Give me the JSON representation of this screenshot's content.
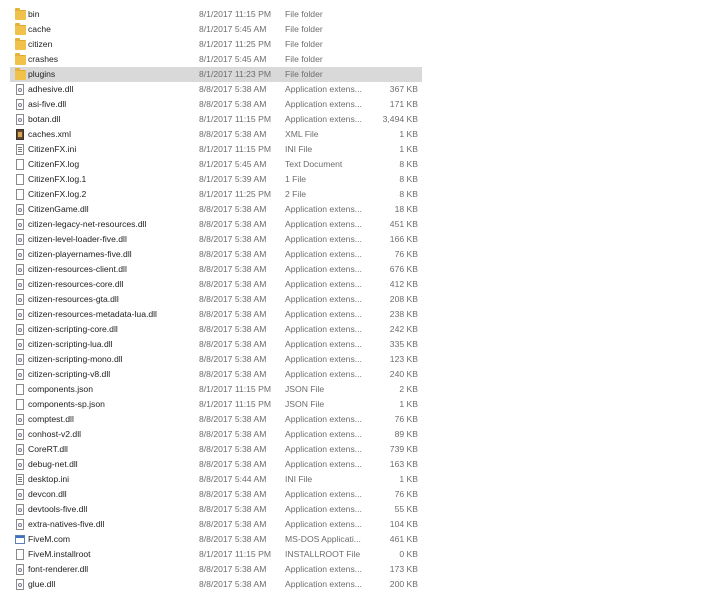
{
  "files": [
    {
      "name": "bin",
      "date": "8/1/2017 11:15 PM",
      "type": "File folder",
      "size": "",
      "icon": "folder-icon"
    },
    {
      "name": "cache",
      "date": "8/1/2017 5:45 AM",
      "type": "File folder",
      "size": "",
      "icon": "folder-icon"
    },
    {
      "name": "citizen",
      "date": "8/1/2017 11:25 PM",
      "type": "File folder",
      "size": "",
      "icon": "folder-icon"
    },
    {
      "name": "crashes",
      "date": "8/1/2017 5:45 AM",
      "type": "File folder",
      "size": "",
      "icon": "folder-icon"
    },
    {
      "name": "plugins",
      "date": "8/1/2017 11:23 PM",
      "type": "File folder",
      "size": "",
      "icon": "folder-icon",
      "selected": true
    },
    {
      "name": "adhesive.dll",
      "date": "8/8/2017 5:38 AM",
      "type": "Application extens...",
      "size": "367 KB",
      "icon": "dll-icon"
    },
    {
      "name": "asi-five.dll",
      "date": "8/8/2017 5:38 AM",
      "type": "Application extens...",
      "size": "171 KB",
      "icon": "dll-icon"
    },
    {
      "name": "botan.dll",
      "date": "8/1/2017 11:15 PM",
      "type": "Application extens...",
      "size": "3,494 KB",
      "icon": "dll-icon"
    },
    {
      "name": "caches.xml",
      "date": "8/8/2017 5:38 AM",
      "type": "XML File",
      "size": "1 KB",
      "icon": "xml-icon"
    },
    {
      "name": "CitizenFX.ini",
      "date": "8/1/2017 11:15 PM",
      "type": "INI File",
      "size": "1 KB",
      "icon": "ini-icon"
    },
    {
      "name": "CitizenFX.log",
      "date": "8/1/2017 5:45 AM",
      "type": "Text Document",
      "size": "8 KB",
      "icon": "file-icon"
    },
    {
      "name": "CitizenFX.log.1",
      "date": "8/1/2017 5:39 AM",
      "type": "1 File",
      "size": "8 KB",
      "icon": "file-icon"
    },
    {
      "name": "CitizenFX.log.2",
      "date": "8/1/2017 11:25 PM",
      "type": "2 File",
      "size": "8 KB",
      "icon": "file-icon"
    },
    {
      "name": "CitizenGame.dll",
      "date": "8/8/2017 5:38 AM",
      "type": "Application extens...",
      "size": "18 KB",
      "icon": "dll-icon"
    },
    {
      "name": "citizen-legacy-net-resources.dll",
      "date": "8/8/2017 5:38 AM",
      "type": "Application extens...",
      "size": "451 KB",
      "icon": "dll-icon"
    },
    {
      "name": "citizen-level-loader-five.dll",
      "date": "8/8/2017 5:38 AM",
      "type": "Application extens...",
      "size": "166 KB",
      "icon": "dll-icon"
    },
    {
      "name": "citizen-playernames-five.dll",
      "date": "8/8/2017 5:38 AM",
      "type": "Application extens...",
      "size": "76 KB",
      "icon": "dll-icon"
    },
    {
      "name": "citizen-resources-client.dll",
      "date": "8/8/2017 5:38 AM",
      "type": "Application extens...",
      "size": "676 KB",
      "icon": "dll-icon"
    },
    {
      "name": "citizen-resources-core.dll",
      "date": "8/8/2017 5:38 AM",
      "type": "Application extens...",
      "size": "412 KB",
      "icon": "dll-icon"
    },
    {
      "name": "citizen-resources-gta.dll",
      "date": "8/8/2017 5:38 AM",
      "type": "Application extens...",
      "size": "208 KB",
      "icon": "dll-icon"
    },
    {
      "name": "citizen-resources-metadata-lua.dll",
      "date": "8/8/2017 5:38 AM",
      "type": "Application extens...",
      "size": "238 KB",
      "icon": "dll-icon"
    },
    {
      "name": "citizen-scripting-core.dll",
      "date": "8/8/2017 5:38 AM",
      "type": "Application extens...",
      "size": "242 KB",
      "icon": "dll-icon"
    },
    {
      "name": "citizen-scripting-lua.dll",
      "date": "8/8/2017 5:38 AM",
      "type": "Application extens...",
      "size": "335 KB",
      "icon": "dll-icon"
    },
    {
      "name": "citizen-scripting-mono.dll",
      "date": "8/8/2017 5:38 AM",
      "type": "Application extens...",
      "size": "123 KB",
      "icon": "dll-icon"
    },
    {
      "name": "citizen-scripting-v8.dll",
      "date": "8/8/2017 5:38 AM",
      "type": "Application extens...",
      "size": "240 KB",
      "icon": "dll-icon"
    },
    {
      "name": "components.json",
      "date": "8/1/2017 11:15 PM",
      "type": "JSON File",
      "size": "2 KB",
      "icon": "file-icon"
    },
    {
      "name": "components-sp.json",
      "date": "8/1/2017 11:15 PM",
      "type": "JSON File",
      "size": "1 KB",
      "icon": "file-icon"
    },
    {
      "name": "comptest.dll",
      "date": "8/8/2017 5:38 AM",
      "type": "Application extens...",
      "size": "76 KB",
      "icon": "dll-icon"
    },
    {
      "name": "conhost-v2.dll",
      "date": "8/8/2017 5:38 AM",
      "type": "Application extens...",
      "size": "89 KB",
      "icon": "dll-icon"
    },
    {
      "name": "CoreRT.dll",
      "date": "8/8/2017 5:38 AM",
      "type": "Application extens...",
      "size": "739 KB",
      "icon": "dll-icon"
    },
    {
      "name": "debug-net.dll",
      "date": "8/8/2017 5:38 AM",
      "type": "Application extens...",
      "size": "163 KB",
      "icon": "dll-icon"
    },
    {
      "name": "desktop.ini",
      "date": "8/8/2017 5:44 AM",
      "type": "INI File",
      "size": "1 KB",
      "icon": "ini-icon"
    },
    {
      "name": "devcon.dll",
      "date": "8/8/2017 5:38 AM",
      "type": "Application extens...",
      "size": "76 KB",
      "icon": "dll-icon"
    },
    {
      "name": "devtools-five.dll",
      "date": "8/8/2017 5:38 AM",
      "type": "Application extens...",
      "size": "55 KB",
      "icon": "dll-icon"
    },
    {
      "name": "extra-natives-five.dll",
      "date": "8/8/2017 5:38 AM",
      "type": "Application extens...",
      "size": "104 KB",
      "icon": "dll-icon"
    },
    {
      "name": "FiveM.com",
      "date": "8/8/2017 5:38 AM",
      "type": "MS-DOS Applicati...",
      "size": "461 KB",
      "icon": "app-icon"
    },
    {
      "name": "FiveM.installroot",
      "date": "8/1/2017 11:15 PM",
      "type": "INSTALLROOT File",
      "size": "0 KB",
      "icon": "file-icon"
    },
    {
      "name": "font-renderer.dll",
      "date": "8/8/2017 5:38 AM",
      "type": "Application extens...",
      "size": "173 KB",
      "icon": "dll-icon"
    },
    {
      "name": "glue.dll",
      "date": "8/8/2017 5:38 AM",
      "type": "Application extens...",
      "size": "200 KB",
      "icon": "dll-icon"
    }
  ]
}
